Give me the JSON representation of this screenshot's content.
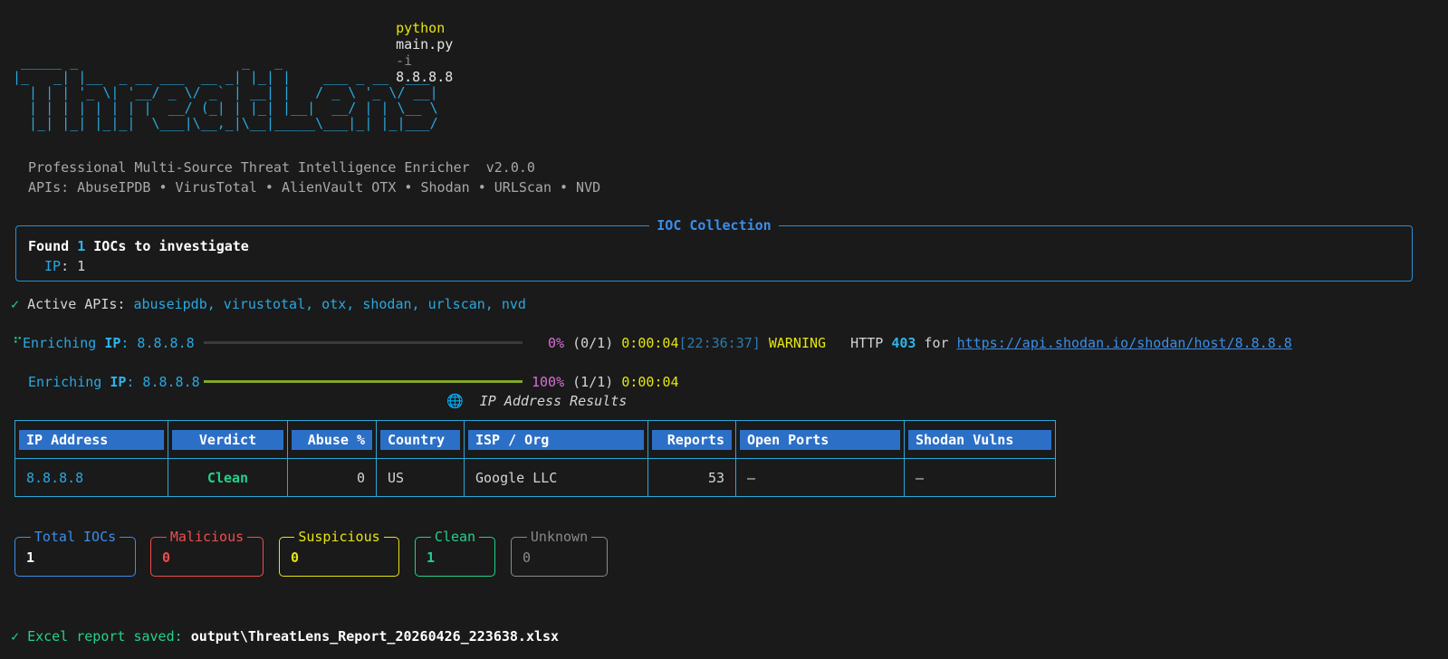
{
  "command": {
    "prog": "python",
    "script": "main.py",
    "flag": "-i",
    "arg": "8.8.8.8"
  },
  "banner_art": " _____ _                    _   _\n|_   _| |__  _ __ ___  __ _| |_| |    ___ _ __  ___\n  | | | '_ \\| '__/ _ \\/ _` | __| |   / _ \\ '_ \\/ __|\n  | | | | | | | |  __/ (_| | |_| |__|  __/ | | \\__ \\\n  |_| |_| |_|_|  \\___|\\__,_|\\__|_____\\___|_| |_|___/",
  "subtitle": "Professional Multi-Source Threat Intelligence Enricher  v2.0.0",
  "apis_line": "APIs: AbuseIPDB • VirusTotal • AlienVault OTX • Shodan • URLScan • NVD",
  "ioc_panel": {
    "title": "IOC Collection",
    "found_prefix": "Found ",
    "found_count": "1",
    "found_suffix": " IOCs to investigate",
    "type_label": "IP",
    "type_value": ": 1"
  },
  "active_apis": {
    "check": "✓",
    "label": "Active APIs: ",
    "list": "abuseipdb, virustotal, otx, shodan, urlscan, nvd"
  },
  "progress1": {
    "spinner": "⠋",
    "label": "Enriching ",
    "type": "IP",
    "target": ": 8.8.8.8",
    "percent_text": "0%",
    "progress": 0,
    "count": "(0/1)",
    "elapsed": "0:00:04",
    "time": "[22:36:37]",
    "level": "WARNING",
    "http_prefix": "HTTP ",
    "http_code": "403",
    "http_for": " for ",
    "url": "https://api.shodan.io/shodan/host/8.8.8.8"
  },
  "progress2": {
    "label": "Enriching ",
    "type": "IP",
    "target": ": 8.8.8.8",
    "percent_text": "100%",
    "progress": 1,
    "count": "(1/1)",
    "elapsed": "0:00:04"
  },
  "results": {
    "icon": "globe-icon",
    "title": "IP Address Results",
    "columns": [
      "IP Address",
      "Verdict",
      "Abuse %",
      "Country",
      "ISP / Org",
      "Reports",
      "Open Ports",
      "Shodan Vulns"
    ],
    "rows": [
      {
        "ip": "8.8.8.8",
        "verdict": "Clean",
        "abuse": "0",
        "country": "US",
        "isp": "Google LLC",
        "reports": "53",
        "ports": "—",
        "vulns": "—"
      }
    ]
  },
  "summary": [
    {
      "label": "Total IOCs",
      "value": "1",
      "color": "#3b8eea"
    },
    {
      "label": "Malicious",
      "value": "0",
      "color": "#f14c4c"
    },
    {
      "label": "Suspicious",
      "value": "0",
      "color": "#e5e510"
    },
    {
      "label": "Clean",
      "value": "1",
      "color": "#23d18b"
    },
    {
      "label": "Unknown",
      "value": "0",
      "color": "#8a8a8a"
    }
  ],
  "report": {
    "check": "✓",
    "label": "Excel report saved: ",
    "path": "output\\ThreatLens_Report_20260426_223638.xlsx"
  },
  "colors": {
    "background": "#1a1a1a",
    "accent_blue": "#29a8e0",
    "header_blue": "#2c6fc7",
    "progress_green": "#7fa829",
    "progress_track": "#3a3a3a"
  }
}
